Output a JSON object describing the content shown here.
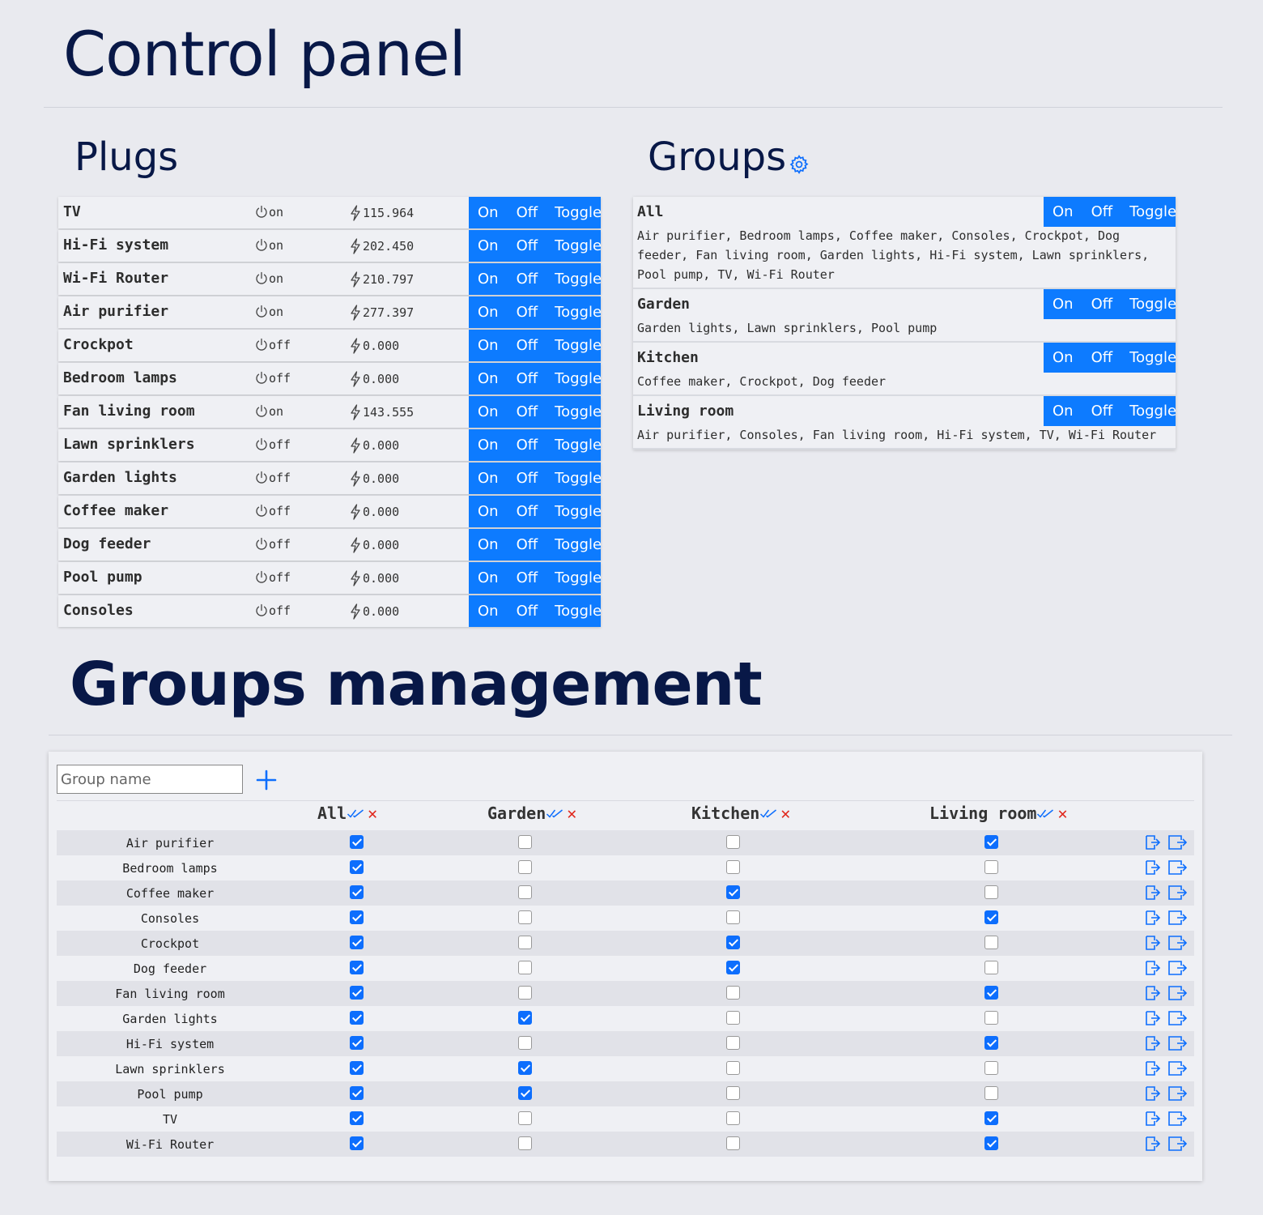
{
  "title": "Control panel",
  "plugs_heading": "Plugs",
  "groups_heading": "Groups",
  "management_heading": "Groups management",
  "button_labels": {
    "on": "On",
    "off": "Off",
    "toggle": "Toggle"
  },
  "colors": {
    "accent": "#0d7bff",
    "heading": "#081847",
    "delete": "#e0271c",
    "background": "#e9eaef"
  },
  "plugs": [
    {
      "name": "TV",
      "state": "on",
      "power": "115.964"
    },
    {
      "name": "Hi-Fi system",
      "state": "on",
      "power": "202.450"
    },
    {
      "name": "Wi-Fi Router",
      "state": "on",
      "power": "210.797"
    },
    {
      "name": "Air purifier",
      "state": "on",
      "power": "277.397"
    },
    {
      "name": "Crockpot",
      "state": "off",
      "power": "0.000"
    },
    {
      "name": "Bedroom lamps",
      "state": "off",
      "power": "0.000"
    },
    {
      "name": "Fan living room",
      "state": "on",
      "power": "143.555"
    },
    {
      "name": "Lawn sprinklers",
      "state": "off",
      "power": "0.000"
    },
    {
      "name": "Garden lights",
      "state": "off",
      "power": "0.000"
    },
    {
      "name": "Coffee maker",
      "state": "off",
      "power": "0.000"
    },
    {
      "name": "Dog feeder",
      "state": "off",
      "power": "0.000"
    },
    {
      "name": "Pool pump",
      "state": "off",
      "power": "0.000"
    },
    {
      "name": "Consoles",
      "state": "off",
      "power": "0.000"
    }
  ],
  "groups": [
    {
      "name": "All",
      "members": "Air purifier, Bedroom lamps, Coffee maker, Consoles, Crockpot, Dog feeder, Fan living room, Garden lights, Hi-Fi system, Lawn sprinklers, Pool pump, TV, Wi-Fi Router"
    },
    {
      "name": "Garden",
      "members": "Garden lights, Lawn sprinklers, Pool pump"
    },
    {
      "name": "Kitchen",
      "members": "Coffee maker, Crockpot, Dog feeder"
    },
    {
      "name": "Living room",
      "members": "Air purifier, Consoles, Fan living room, Hi-Fi system, TV, Wi-Fi Router"
    }
  ],
  "management": {
    "group_name_placeholder": "Group name",
    "group_name_value": "",
    "add_icon": "plus-icon",
    "columns": [
      "All",
      "Garden",
      "Kitchen",
      "Living room"
    ],
    "rows": [
      {
        "name": "Air purifier",
        "checks": [
          true,
          false,
          false,
          true
        ]
      },
      {
        "name": "Bedroom lamps",
        "checks": [
          true,
          false,
          false,
          false
        ]
      },
      {
        "name": "Coffee maker",
        "checks": [
          true,
          false,
          true,
          false
        ]
      },
      {
        "name": "Consoles",
        "checks": [
          true,
          false,
          false,
          true
        ]
      },
      {
        "name": "Crockpot",
        "checks": [
          true,
          false,
          true,
          false
        ]
      },
      {
        "name": "Dog feeder",
        "checks": [
          true,
          false,
          true,
          false
        ]
      },
      {
        "name": "Fan living room",
        "checks": [
          true,
          false,
          false,
          true
        ]
      },
      {
        "name": "Garden lights",
        "checks": [
          true,
          true,
          false,
          false
        ]
      },
      {
        "name": "Hi-Fi system",
        "checks": [
          true,
          false,
          false,
          true
        ]
      },
      {
        "name": "Lawn sprinklers",
        "checks": [
          true,
          true,
          false,
          false
        ]
      },
      {
        "name": "Pool pump",
        "checks": [
          true,
          true,
          false,
          false
        ]
      },
      {
        "name": "TV",
        "checks": [
          true,
          false,
          false,
          true
        ]
      },
      {
        "name": "Wi-Fi Router",
        "checks": [
          true,
          false,
          false,
          true
        ]
      }
    ]
  }
}
